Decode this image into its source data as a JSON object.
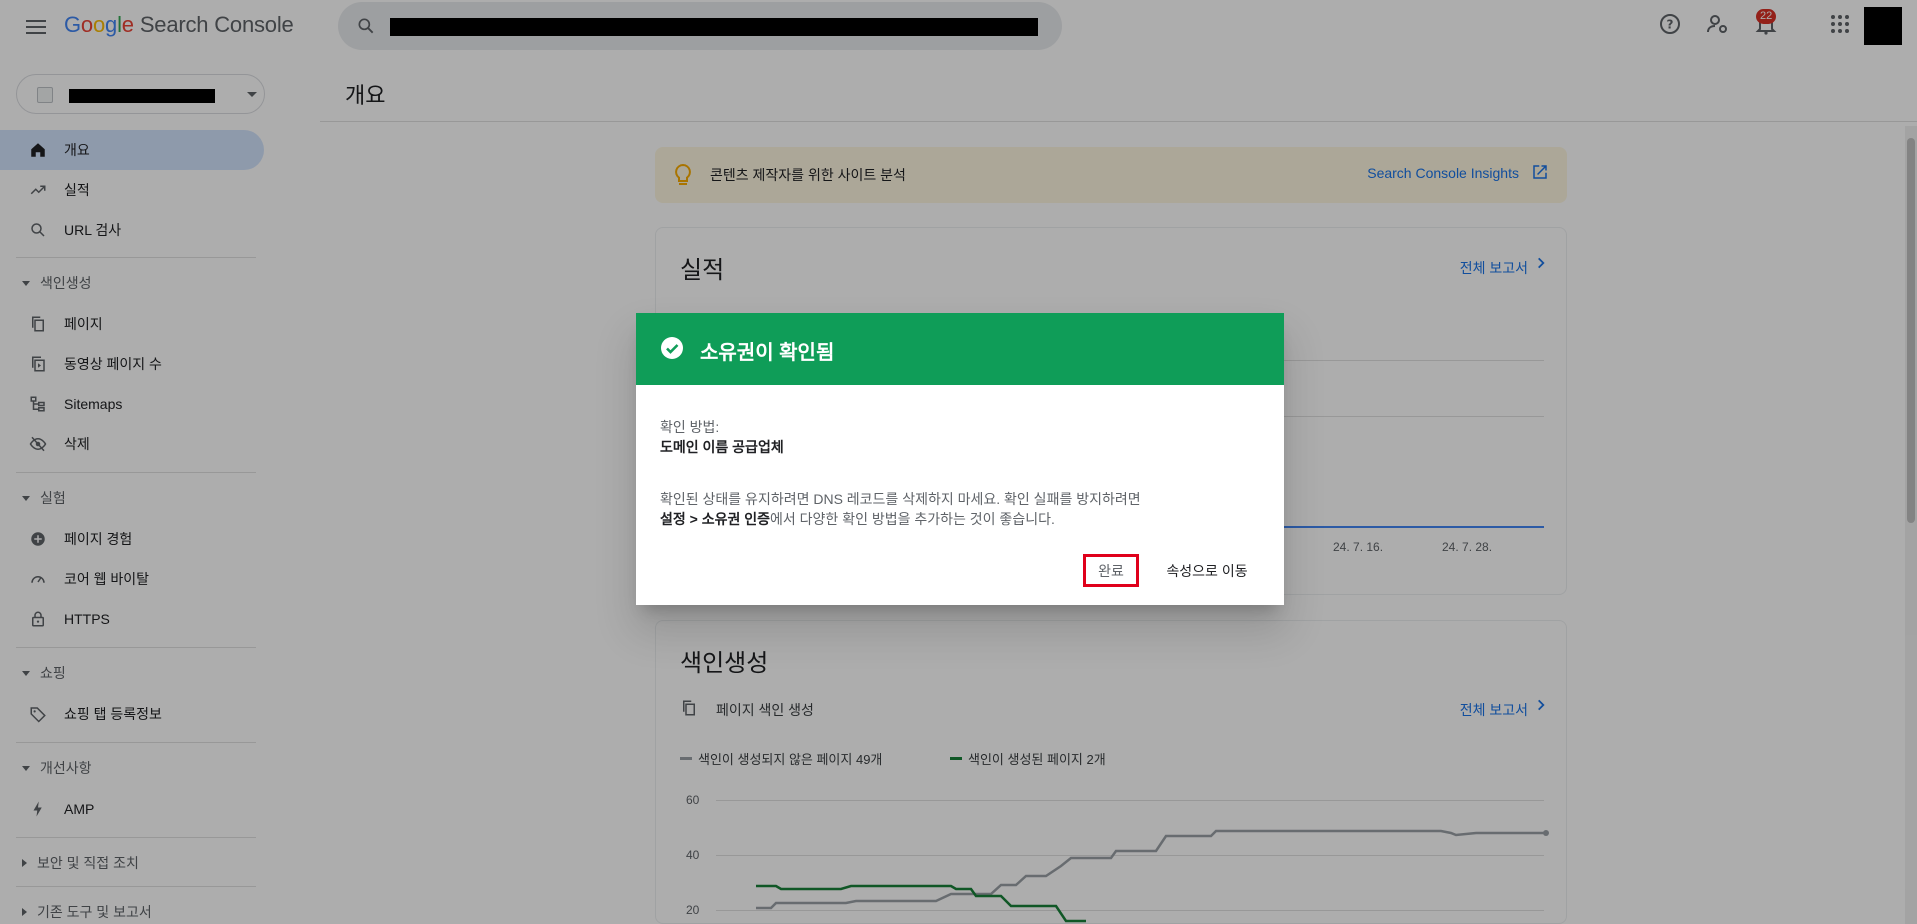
{
  "header": {
    "logo_letters": [
      "G",
      "o",
      "o",
      "g",
      "l",
      "e"
    ],
    "product": "Search Console",
    "notification_count": "22"
  },
  "sidebar": {
    "items": [
      {
        "label": "개요",
        "icon": "home-icon"
      },
      {
        "label": "실적",
        "icon": "trending-up-icon"
      },
      {
        "label": "URL 검사",
        "icon": "search-icon"
      }
    ],
    "sections": [
      {
        "title": "색인생성",
        "items": [
          {
            "label": "페이지",
            "icon": "pages-icon"
          },
          {
            "label": "동영상 페이지 수",
            "icon": "video-pages-icon"
          },
          {
            "label": "Sitemaps",
            "icon": "sitemap-icon"
          },
          {
            "label": "삭제",
            "icon": "visibility-off-icon"
          }
        ]
      },
      {
        "title": "실험",
        "items": [
          {
            "label": "페이지 경험",
            "icon": "add-circle-icon"
          },
          {
            "label": "코어 웹 바이탈",
            "icon": "speed-icon"
          },
          {
            "label": "HTTPS",
            "icon": "lock-icon"
          }
        ]
      },
      {
        "title": "쇼핑",
        "items": [
          {
            "label": "쇼핑 탭 등록정보",
            "icon": "tag-icon"
          }
        ]
      },
      {
        "title": "개선사항",
        "items": [
          {
            "label": "AMP",
            "icon": "bolt-icon"
          }
        ]
      },
      {
        "title": "보안 및 직접 조치",
        "items": []
      },
      {
        "title": "기존 도구 및 보고서",
        "items": []
      }
    ]
  },
  "main": {
    "page_title": "개요",
    "insights_text": "콘텐츠 제작자를 위한 사이트 분석",
    "insights_link": "Search Console Insights",
    "performance": {
      "title": "실적",
      "full_report": "전체 보고서",
      "x_ticks": [
        "24. 7. 16.",
        "24. 7. 28."
      ]
    },
    "indexing": {
      "title": "색인생성",
      "subtitle": "페이지 색인 생성",
      "full_report": "전체 보고서",
      "legend_not_indexed": "색인이 생성되지 않은 페이지 49개",
      "legend_indexed": "색인이 생성된 페이지 2개",
      "y_ticks": [
        "60",
        "40",
        "20"
      ]
    }
  },
  "dialog": {
    "title": "소유권이 확인됨",
    "method_label": "확인 방법:",
    "method_value": "도메인 이름 공급업체",
    "note_line1": "확인된 상태를 유지하려면 DNS 레코드를 삭제하지 마세요. 확인 실패를 방지하려면",
    "note_bold": "설정 > 소유권 인증",
    "note_line2_rest": "에서 다양한 확인 방법을 추가하는 것이 좋습니다.",
    "done_label": "완료",
    "goto_label": "속성으로 이동"
  },
  "colors": {
    "dialog_header": "#0f9d58",
    "accent_blue": "#1a73e8",
    "not_indexed_line": "#9aa0a6",
    "indexed_line": "#188038",
    "highlight_box": "#e0001b"
  }
}
